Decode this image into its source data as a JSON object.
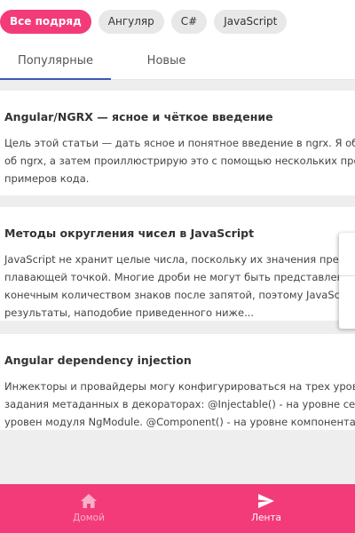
{
  "chips": [
    "Все подряд",
    "Ангуляр",
    "C#",
    "JavaScript"
  ],
  "tabs": [
    "Популярные",
    "Новые"
  ],
  "articles": [
    {
      "title": "Angular/NGRX — ясное и чёткое введение",
      "lines": [
        "Цель этой статьи — дать ясное и понятное введение в ngrx. Я объясню",
        "об ngrx, а затем проиллюстрирую это с помощью нескольких простых",
        "примеров кода."
      ]
    },
    {
      "title": "Методы округления чисел в JavaScript",
      "lines": [
        "JavaScript не хранит целые числа, поскольку их значения представ",
        "плавающей точкой. Многие дроби не могут быть представлены чи",
        "конечным количеством знаков после запятой, поэтому JavaScript м",
        "результаты, наподобие приведенного ниже..."
      ]
    },
    {
      "title": "Angular dependency injection",
      "lines": [
        "Инжекторы и провайдеры могу конфигурироваться на трех уровнях п",
        "задания метаданных в декораторах: @Injectable() - на уровне сервиса",
        "уровен модуля NgModule. @Component() - на уровне компонента."
      ]
    }
  ],
  "bottom_nav": {
    "home": "Домой",
    "feed": "Лента"
  },
  "colors": {
    "accent": "#f33b7a",
    "tab_indicator": "#3a58b5"
  }
}
